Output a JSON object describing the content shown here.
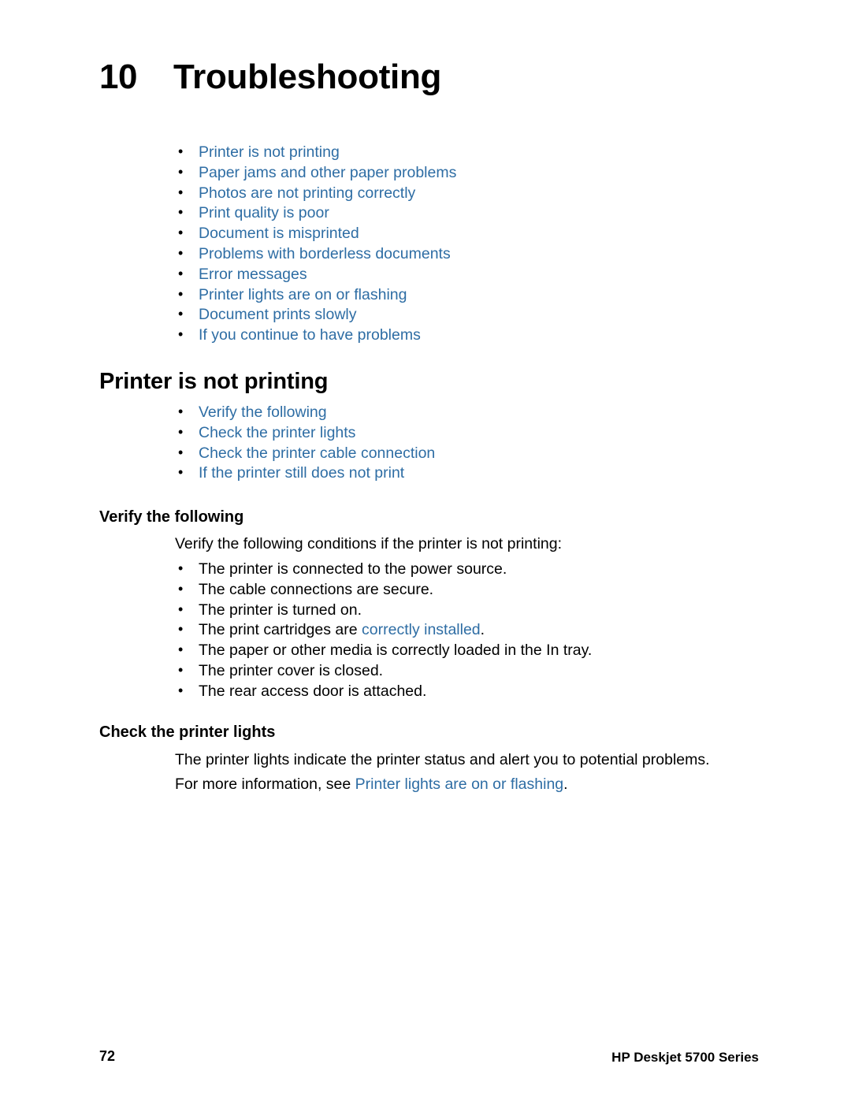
{
  "chapter": {
    "number": "10",
    "title": "Troubleshooting"
  },
  "top_links": [
    "Printer is not printing",
    "Paper jams and other paper problems",
    "Photos are not printing correctly",
    "Print quality is poor",
    "Document is misprinted",
    "Problems with borderless documents",
    "Error messages",
    "Printer lights are on or flashing",
    "Document prints slowly",
    "If you continue to have problems"
  ],
  "section": {
    "heading": "Printer is not printing",
    "links": [
      "Verify the following",
      "Check the printer lights",
      "Check the printer cable connection",
      "If the printer still does not print"
    ]
  },
  "verify": {
    "heading": "Verify the following",
    "intro": "Verify the following conditions if the printer is not printing:",
    "items": [
      {
        "text": "The printer is connected to the power source.",
        "link": "",
        "tail": ""
      },
      {
        "text": "The cable connections are secure.",
        "link": "",
        "tail": ""
      },
      {
        "text": "The printer is turned on.",
        "link": "",
        "tail": ""
      },
      {
        "text": "The print cartridges are ",
        "link": "correctly installed",
        "tail": "."
      },
      {
        "text": "The paper or other media is correctly loaded in the In tray.",
        "link": "",
        "tail": ""
      },
      {
        "text": "The printer cover is closed.",
        "link": "",
        "tail": ""
      },
      {
        "text": "The rear access door is attached.",
        "link": "",
        "tail": ""
      }
    ]
  },
  "lights": {
    "heading": "Check the printer lights",
    "para1": "The printer lights indicate the printer status and alert you to potential problems.",
    "para2_prefix": "For more information, see ",
    "para2_link": "Printer lights are on or flashing",
    "para2_tail": "."
  },
  "footer": {
    "page_number": "72",
    "product": "HP Deskjet 5700 Series"
  },
  "colors": {
    "link": "#2e6da4",
    "text": "#000000",
    "background": "#ffffff"
  }
}
